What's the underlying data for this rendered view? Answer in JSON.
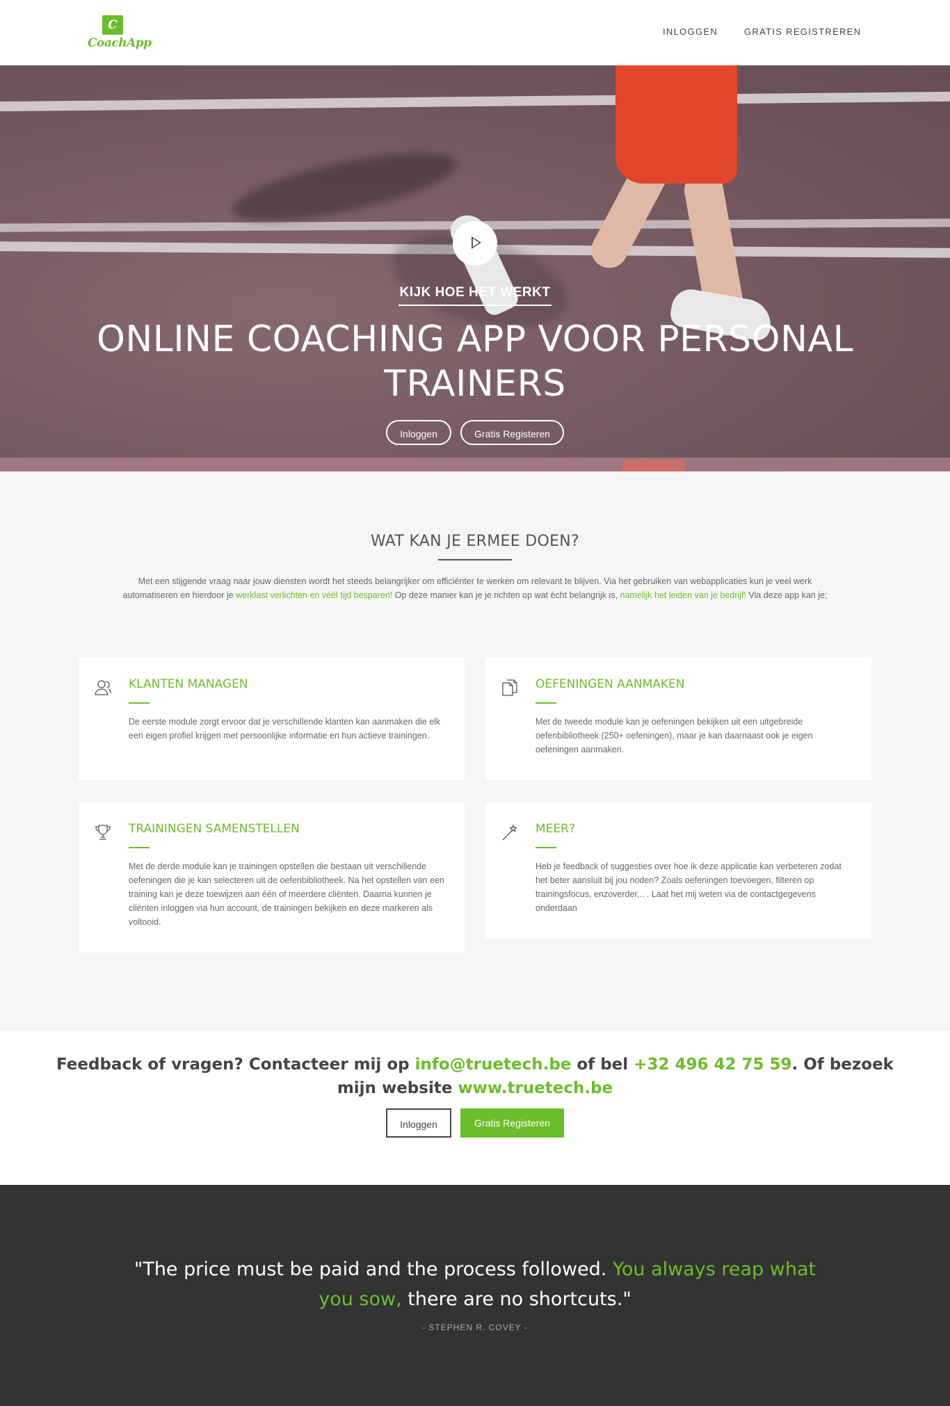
{
  "brand": {
    "logo_letter": "C",
    "logo_text": "CoachApp"
  },
  "nav": {
    "login": "INLOGGEN",
    "register": "GRATIS REGISTREREN"
  },
  "hero": {
    "how_link": "KIJK HOE HET WERKT",
    "title": "ONLINE COACHING APP VOOR PERSONAL TRAINERS",
    "login_button": "Inloggen",
    "register_button": "Gratis Registeren"
  },
  "features": {
    "title": "WAT KAN JE ERMEE DOEN?",
    "intro": {
      "part1": "Met een stijgende vraag naar jouw diensten wordt het steeds belangrijker om efficiënter te werken om relevant te blijven. Via het gebruiken van webapplicaties kun je veel werk automatiseren en hierdoor je ",
      "link1": "werklast verlichten en véél tijd besparen!",
      "part2": " Op deze manier kan je je richten op wat écht belangrijk is, ",
      "link2": "namelijk het leiden van je bedrijf!",
      "part3": " Via deze app kan je;"
    },
    "cards": [
      {
        "icon": "user-icon",
        "title": "KLANTEN MANAGEN",
        "text": "De eerste module zorgt ervoor dat je verschillende klanten kan aanmaken die elk een eigen profiel krijgen met persoonlijke informatie en hun actieve trainingen."
      },
      {
        "icon": "documents-icon",
        "title": "OEFENINGEN AANMAKEN",
        "text": "Met de tweede module kan je oefeningen bekijken uit een uitgebreide oefenbibliotheek (250+ oefeningen), maar je kan daarnaast ook je eigen oefeningen aanmaken."
      },
      {
        "icon": "trophy-icon",
        "title": "TRAININGEN SAMENSTELLEN",
        "text": "Met de derde module kan je trainingen opstellen die bestaan uit verschillende oefeningen die je kan selecteren uit de oefenbibliotheek. Na het opstellen van een training kan je deze toewijzen aan één of meerdere cliënten. Daarna kunnen je cliënten inloggen via hun account, de trainingen bekijken en deze markeren als voltooid."
      },
      {
        "icon": "magic-wand-icon",
        "title": "MEER?",
        "text": "Heb je feedback of suggesties over hoe ik deze applicatie kan verbeteren zodat het beter aansluit bij jou noden? Zoals oefeningen toevoegen, filteren op trainingsfocus, enzoverder,.. . Laat het mij weten via de contactgegevens onderdaan"
      }
    ]
  },
  "contact": {
    "text1": "Feedback of vragen? Contacteer mij op ",
    "email": "info@truetech.be",
    "text2": " of bel ",
    "phone": "+32 496 42 75 59",
    "text3": ". Of bezoek mijn website ",
    "website": "www.truetech.be",
    "login_button": "Inloggen",
    "register_button": "Gratis Registeren"
  },
  "quote": {
    "open": "\"",
    "part1": "The price must be paid and the process followed. ",
    "highlight": "You always reap what you sow,",
    "part2": " there are no shortcuts.",
    "close": "\"",
    "author": "- STEPHEN R. COVEY -"
  },
  "colors": {
    "accent": "#6cbd2b",
    "dark": "#333333",
    "light_bg": "#f6f6f6"
  }
}
